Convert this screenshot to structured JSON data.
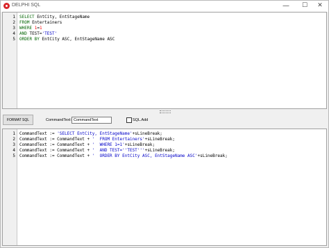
{
  "window": {
    "title": "DELPHI SQL",
    "minimize_glyph": "—",
    "maximize_glyph": "☐",
    "close_glyph": "✕"
  },
  "sql_editor": {
    "lines": [
      {
        "num": "1",
        "tokens": [
          {
            "t": "SELECT",
            "c": "kw"
          },
          {
            "t": " EntCity, EntStageName",
            "c": "id"
          }
        ]
      },
      {
        "num": "2",
        "tokens": [
          {
            "t": "FROM",
            "c": "kw"
          },
          {
            "t": " Entertainers",
            "c": "id"
          }
        ]
      },
      {
        "num": "3",
        "tokens": [
          {
            "t": "WHERE",
            "c": "kw"
          },
          {
            "t": " ",
            "c": "id"
          },
          {
            "t": "1",
            "c": "num"
          },
          {
            "t": "=",
            "c": "id"
          },
          {
            "t": "1",
            "c": "num"
          }
        ]
      },
      {
        "num": "4",
        "tokens": [
          {
            "t": "AND",
            "c": "kw"
          },
          {
            "t": " TEST=",
            "c": "id"
          },
          {
            "t": "'TEST'",
            "c": "str"
          }
        ]
      },
      {
        "num": "5",
        "tokens": [
          {
            "t": "ORDER BY",
            "c": "kw"
          },
          {
            "t": " EntCity ASC, EntStageName ASC",
            "c": "id"
          }
        ]
      }
    ]
  },
  "toolbar": {
    "format_button": "FORMAT SQL",
    "commandtext_label": "CommandText:",
    "commandtext_value": "CommandText",
    "sqladd_label": "SQL.Add"
  },
  "delphi_editor": {
    "lines": [
      {
        "num": "1",
        "tokens": [
          {
            "t": "CommandText := ",
            "c": "id"
          },
          {
            "t": "'SELECT EntCity, EntStageName'",
            "c": "str"
          },
          {
            "t": "+sLineBreak;",
            "c": "id"
          }
        ]
      },
      {
        "num": "2",
        "tokens": [
          {
            "t": "CommandText := CommandText + ",
            "c": "id"
          },
          {
            "t": "'  FROM Entertainers'",
            "c": "str"
          },
          {
            "t": "+sLineBreak;",
            "c": "id"
          }
        ]
      },
      {
        "num": "3",
        "tokens": [
          {
            "t": "CommandText := CommandText + ",
            "c": "id"
          },
          {
            "t": "'  WHERE 1=1'",
            "c": "str"
          },
          {
            "t": "+sLineBreak;",
            "c": "id"
          }
        ]
      },
      {
        "num": "4",
        "tokens": [
          {
            "t": "CommandText := CommandText + ",
            "c": "id"
          },
          {
            "t": "'  AND TEST=''TEST'''",
            "c": "str"
          },
          {
            "t": "+sLineBreak;",
            "c": "id"
          }
        ]
      },
      {
        "num": "5",
        "tokens": [
          {
            "t": "CommandText := CommandText + ",
            "c": "id"
          },
          {
            "t": "'  ORDER BY EntCity ASC, EntStageName ASC'",
            "c": "str"
          },
          {
            "t": "+sLineBreak;",
            "c": "id"
          }
        ]
      }
    ]
  }
}
